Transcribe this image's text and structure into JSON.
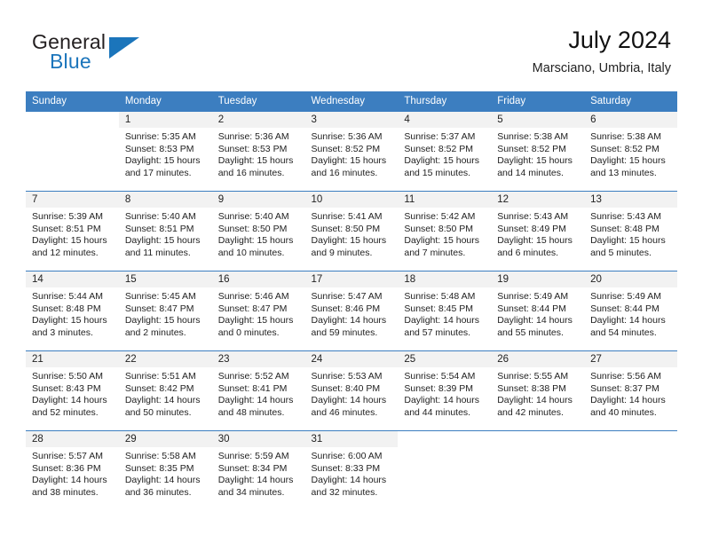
{
  "logo": {
    "word_top": "General",
    "word_bottom": "Blue",
    "triangle_color": "#1b75bb"
  },
  "header": {
    "title": "July 2024",
    "subtitle": "Marsciano, Umbria, Italy"
  },
  "theme": {
    "header_blue": "#3c7ec0",
    "daynum_band": "#f2f2f2",
    "text": "#222222"
  },
  "calendar": {
    "weekday_headers": [
      "Sunday",
      "Monday",
      "Tuesday",
      "Wednesday",
      "Thursday",
      "Friday",
      "Saturday"
    ],
    "labels": {
      "sunrise": "Sunrise:",
      "sunset": "Sunset:",
      "daylight": "Daylight:"
    },
    "weeks": [
      [
        {
          "day": "",
          "sunrise": "",
          "sunset": "",
          "daylight": ""
        },
        {
          "day": "1",
          "sunrise": "Sunrise: 5:35 AM",
          "sunset": "Sunset: 8:53 PM",
          "daylight": "Daylight: 15 hours and 17 minutes."
        },
        {
          "day": "2",
          "sunrise": "Sunrise: 5:36 AM",
          "sunset": "Sunset: 8:53 PM",
          "daylight": "Daylight: 15 hours and 16 minutes."
        },
        {
          "day": "3",
          "sunrise": "Sunrise: 5:36 AM",
          "sunset": "Sunset: 8:52 PM",
          "daylight": "Daylight: 15 hours and 16 minutes."
        },
        {
          "day": "4",
          "sunrise": "Sunrise: 5:37 AM",
          "sunset": "Sunset: 8:52 PM",
          "daylight": "Daylight: 15 hours and 15 minutes."
        },
        {
          "day": "5",
          "sunrise": "Sunrise: 5:38 AM",
          "sunset": "Sunset: 8:52 PM",
          "daylight": "Daylight: 15 hours and 14 minutes."
        },
        {
          "day": "6",
          "sunrise": "Sunrise: 5:38 AM",
          "sunset": "Sunset: 8:52 PM",
          "daylight": "Daylight: 15 hours and 13 minutes."
        }
      ],
      [
        {
          "day": "7",
          "sunrise": "Sunrise: 5:39 AM",
          "sunset": "Sunset: 8:51 PM",
          "daylight": "Daylight: 15 hours and 12 minutes."
        },
        {
          "day": "8",
          "sunrise": "Sunrise: 5:40 AM",
          "sunset": "Sunset: 8:51 PM",
          "daylight": "Daylight: 15 hours and 11 minutes."
        },
        {
          "day": "9",
          "sunrise": "Sunrise: 5:40 AM",
          "sunset": "Sunset: 8:50 PM",
          "daylight": "Daylight: 15 hours and 10 minutes."
        },
        {
          "day": "10",
          "sunrise": "Sunrise: 5:41 AM",
          "sunset": "Sunset: 8:50 PM",
          "daylight": "Daylight: 15 hours and 9 minutes."
        },
        {
          "day": "11",
          "sunrise": "Sunrise: 5:42 AM",
          "sunset": "Sunset: 8:50 PM",
          "daylight": "Daylight: 15 hours and 7 minutes."
        },
        {
          "day": "12",
          "sunrise": "Sunrise: 5:43 AM",
          "sunset": "Sunset: 8:49 PM",
          "daylight": "Daylight: 15 hours and 6 minutes."
        },
        {
          "day": "13",
          "sunrise": "Sunrise: 5:43 AM",
          "sunset": "Sunset: 8:48 PM",
          "daylight": "Daylight: 15 hours and 5 minutes."
        }
      ],
      [
        {
          "day": "14",
          "sunrise": "Sunrise: 5:44 AM",
          "sunset": "Sunset: 8:48 PM",
          "daylight": "Daylight: 15 hours and 3 minutes."
        },
        {
          "day": "15",
          "sunrise": "Sunrise: 5:45 AM",
          "sunset": "Sunset: 8:47 PM",
          "daylight": "Daylight: 15 hours and 2 minutes."
        },
        {
          "day": "16",
          "sunrise": "Sunrise: 5:46 AM",
          "sunset": "Sunset: 8:47 PM",
          "daylight": "Daylight: 15 hours and 0 minutes."
        },
        {
          "day": "17",
          "sunrise": "Sunrise: 5:47 AM",
          "sunset": "Sunset: 8:46 PM",
          "daylight": "Daylight: 14 hours and 59 minutes."
        },
        {
          "day": "18",
          "sunrise": "Sunrise: 5:48 AM",
          "sunset": "Sunset: 8:45 PM",
          "daylight": "Daylight: 14 hours and 57 minutes."
        },
        {
          "day": "19",
          "sunrise": "Sunrise: 5:49 AM",
          "sunset": "Sunset: 8:44 PM",
          "daylight": "Daylight: 14 hours and 55 minutes."
        },
        {
          "day": "20",
          "sunrise": "Sunrise: 5:49 AM",
          "sunset": "Sunset: 8:44 PM",
          "daylight": "Daylight: 14 hours and 54 minutes."
        }
      ],
      [
        {
          "day": "21",
          "sunrise": "Sunrise: 5:50 AM",
          "sunset": "Sunset: 8:43 PM",
          "daylight": "Daylight: 14 hours and 52 minutes."
        },
        {
          "day": "22",
          "sunrise": "Sunrise: 5:51 AM",
          "sunset": "Sunset: 8:42 PM",
          "daylight": "Daylight: 14 hours and 50 minutes."
        },
        {
          "day": "23",
          "sunrise": "Sunrise: 5:52 AM",
          "sunset": "Sunset: 8:41 PM",
          "daylight": "Daylight: 14 hours and 48 minutes."
        },
        {
          "day": "24",
          "sunrise": "Sunrise: 5:53 AM",
          "sunset": "Sunset: 8:40 PM",
          "daylight": "Daylight: 14 hours and 46 minutes."
        },
        {
          "day": "25",
          "sunrise": "Sunrise: 5:54 AM",
          "sunset": "Sunset: 8:39 PM",
          "daylight": "Daylight: 14 hours and 44 minutes."
        },
        {
          "day": "26",
          "sunrise": "Sunrise: 5:55 AM",
          "sunset": "Sunset: 8:38 PM",
          "daylight": "Daylight: 14 hours and 42 minutes."
        },
        {
          "day": "27",
          "sunrise": "Sunrise: 5:56 AM",
          "sunset": "Sunset: 8:37 PM",
          "daylight": "Daylight: 14 hours and 40 minutes."
        }
      ],
      [
        {
          "day": "28",
          "sunrise": "Sunrise: 5:57 AM",
          "sunset": "Sunset: 8:36 PM",
          "daylight": "Daylight: 14 hours and 38 minutes."
        },
        {
          "day": "29",
          "sunrise": "Sunrise: 5:58 AM",
          "sunset": "Sunset: 8:35 PM",
          "daylight": "Daylight: 14 hours and 36 minutes."
        },
        {
          "day": "30",
          "sunrise": "Sunrise: 5:59 AM",
          "sunset": "Sunset: 8:34 PM",
          "daylight": "Daylight: 14 hours and 34 minutes."
        },
        {
          "day": "31",
          "sunrise": "Sunrise: 6:00 AM",
          "sunset": "Sunset: 8:33 PM",
          "daylight": "Daylight: 14 hours and 32 minutes."
        },
        {
          "day": "",
          "sunrise": "",
          "sunset": "",
          "daylight": ""
        },
        {
          "day": "",
          "sunrise": "",
          "sunset": "",
          "daylight": ""
        },
        {
          "day": "",
          "sunrise": "",
          "sunset": "",
          "daylight": ""
        }
      ]
    ]
  }
}
